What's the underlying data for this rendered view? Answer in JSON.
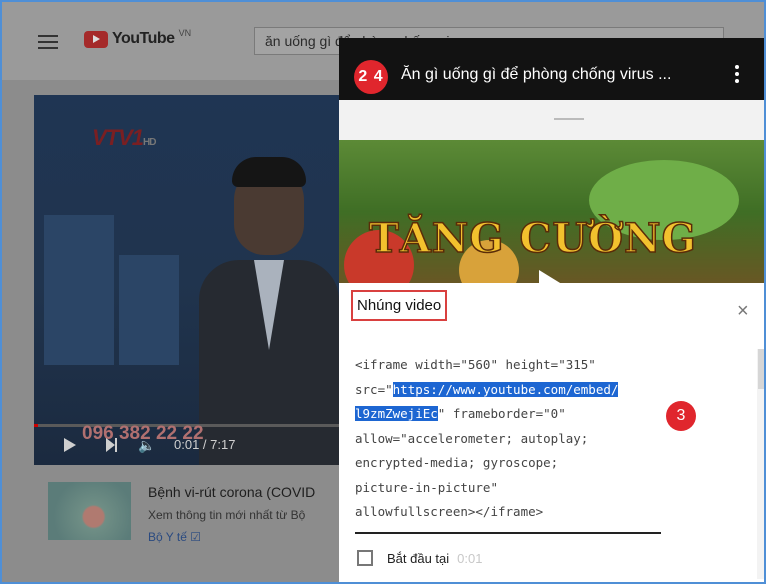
{
  "youtube": {
    "logo_text": "YouTube",
    "region": "VN",
    "search_value": "ăn uống gì để phòng chống virus"
  },
  "player": {
    "channel_logo": "VTV1",
    "channel_suffix": "HD",
    "phone_overlay": "096 382 22 22",
    "time": "0:01 / 7:17",
    "volume_icon": "speaker-icon"
  },
  "ad": {
    "title": "Bệnh vi-rút corona (COVID",
    "description": "Xem thông tin mới nhất từ Bộ",
    "source": "Bộ Y tế ☑"
  },
  "dialog": {
    "step_badge": "2 4",
    "video_title": "Ăn gì uống gì để phòng chống virus ...",
    "thumbnail_banner": "TĂNG CƯỜNG",
    "embed_title": "Nhúng video",
    "close": "×",
    "code": {
      "line1": "<iframe width=\"560\" height=\"315\"",
      "line2_pre": "src=\"",
      "line2_hl": "https://www.youtube.com/embed/",
      "line3_hl": "l9zmZwejiEc",
      "line3_post": "\" frameborder=\"0\"",
      "line4": "allow=\"accelerometer; autoplay;",
      "line5": "encrypted-media; gyroscope;",
      "line6": "picture-in-picture\"",
      "line7": "allowfullscreen></iframe>"
    },
    "step3_badge": "3",
    "start_at_label": "Bắt đầu tại",
    "start_at_time": "0:01"
  },
  "colors": {
    "accent_red": "#e0262d",
    "selection_blue": "#1d66d2",
    "frame_border": "#4f8fd6"
  }
}
